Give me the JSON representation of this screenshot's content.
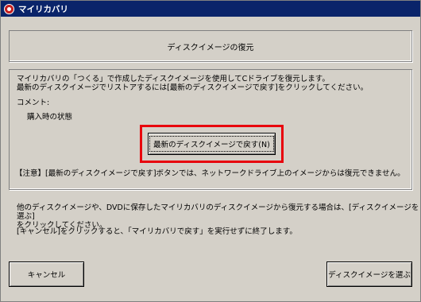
{
  "window": {
    "title": "マイリカバリ"
  },
  "header": {
    "title": "ディスクイメージの復元"
  },
  "main": {
    "description_line1": "マイリカバリの「つくる」で作成したディスクイメージを使用してCドライブを復元します。",
    "description_line2": "最新のディスクイメージでリストアするには[最新のディスクイメージで戻す]をクリックしてください。",
    "comment_label": "コメント:",
    "comment_value": "購入時の状態",
    "restore_button_label": "最新のディスクイメージで戻す(N)",
    "notice": "【注意】[最新のディスクイメージで戻す]ボタンでは、ネットワークドライブ上のイメージからは復元できません。"
  },
  "info": {
    "line1": "他のディスクイメージや、DVDに保存したマイリカバリのディスクイメージから復元する場合は、[ディスクイメージを選ぶ]",
    "line2": "をクリックしてください。",
    "line3": "[キャンセル]をクリックすると、「マイリカバリで戻す」を実行せずに終了します。"
  },
  "footer": {
    "cancel_label": "キャンセル",
    "choose_label": "ディスクイメージを選ぶ"
  },
  "colors": {
    "titlebar": "#0a246a",
    "face": "#d4d0c8",
    "highlight": "#e8000c"
  },
  "icons": {
    "app": "recovery-app-icon"
  }
}
